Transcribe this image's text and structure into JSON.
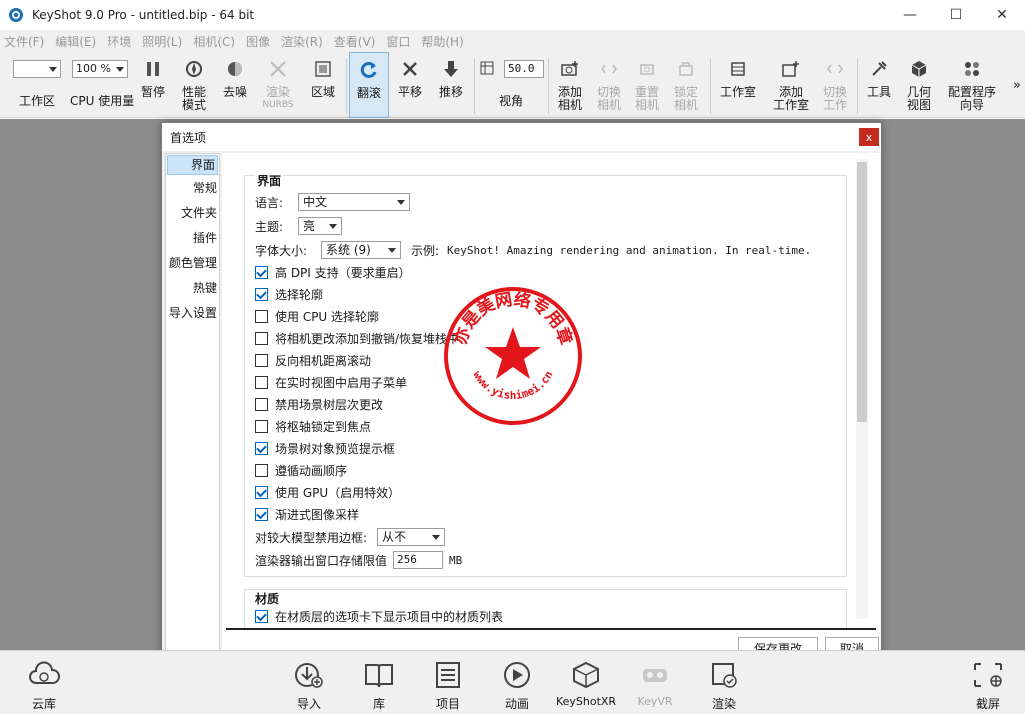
{
  "window": {
    "title": "KeyShot 9.0 Pro  - untitled.bip  - 64 bit",
    "controls": [
      "—",
      "☐",
      "✕"
    ]
  },
  "menu": [
    "文件(F)",
    "编辑(E)",
    "环境",
    "照明(L)",
    "相机(C)",
    "图像",
    "渲染(R)",
    "查看(V)",
    "窗口",
    "帮助(H)"
  ],
  "toolbar": {
    "workspace_label": "工作区",
    "cpu_value": "100 %",
    "cpu_label": "CPU 使用量",
    "pause": "暂停",
    "perf_mode": [
      "性能",
      "模式"
    ],
    "denoise": "去噪",
    "render_nurbs": [
      "渲染",
      "NURBS"
    ],
    "region": "区域",
    "tumble": "翻滚",
    "pan": "平移",
    "dolly": "推移",
    "fov_value": "50.0",
    "fov_label": "视角",
    "add_camera": [
      "添加",
      "相机"
    ],
    "switch_camera": [
      "切换",
      "相机"
    ],
    "reset_camera": [
      "重置",
      "相机"
    ],
    "lock_camera": [
      "锁定",
      "相机"
    ],
    "studio": "工作室",
    "add_studio": [
      "添加",
      "工作室"
    ],
    "switch_work": [
      "切换",
      "工作"
    ],
    "tools": "工具",
    "geometry_view": [
      "几何",
      "视图"
    ],
    "config_wizard": [
      "配置程序",
      "向导"
    ],
    "overflow": "»"
  },
  "dialog": {
    "title": "首选项",
    "close": "x",
    "nav": [
      "界面",
      "常规",
      "文件夹",
      "插件",
      "颜色管理",
      "热键",
      "导入设置"
    ],
    "section_title": "界面",
    "language_label": "语言:",
    "language_value": "中文",
    "theme_label": "主题:",
    "theme_value": "亮",
    "font_size_label": "字体大小:",
    "font_size_value": "系统 (9)",
    "example_label": "示例:",
    "example_text": "KeyShot! Amazing rendering and animation. In real-time.",
    "checkboxes": [
      {
        "label": "高 DPI 支持（要求重启）",
        "checked": true
      },
      {
        "label": "选择轮廓",
        "checked": true
      },
      {
        "label": "使用 CPU 选择轮廓",
        "checked": false
      },
      {
        "label": "将相机更改添加到撤销/恢复堆栈中",
        "checked": false
      },
      {
        "label": "反向相机距离滚动",
        "checked": false
      },
      {
        "label": "在实时视图中启用子菜单",
        "checked": false
      },
      {
        "label": "禁用场景树层次更改",
        "checked": false
      },
      {
        "label": "将枢轴锁定到焦点",
        "checked": false
      },
      {
        "label": "场景树对象预览提示框",
        "checked": true
      },
      {
        "label": "遵循动画顺序",
        "checked": false
      },
      {
        "label": "使用 GPU（启用特效）",
        "checked": true
      },
      {
        "label": "渐进式图像采样",
        "checked": true
      }
    ],
    "large_model_label": "对较大模型禁用边框:",
    "large_model_value": "从不",
    "render_limit_label": "渲染器输出窗口存储限值",
    "render_limit_value": "256",
    "render_limit_unit": "MB",
    "section2_title": "材质",
    "section2_partial": "在材质层的选项卡下显示项目中的材质列表",
    "save_button": "保存更改",
    "cancel_button": "取消"
  },
  "stamp": {
    "text": "亦是美网络专用章",
    "url": "www.yishimei.cn",
    "color": "#e2161b"
  },
  "bottombar": [
    "云库",
    "导入",
    "库",
    "项目",
    "动画",
    "KeyShotXR",
    "KeyVR",
    "渲染",
    "截屏"
  ],
  "colors": {
    "accent": "#0065c2",
    "active_tool": "#d6e8f6",
    "viewport": "#8c8c8c",
    "close_red": "#c42b1c"
  }
}
